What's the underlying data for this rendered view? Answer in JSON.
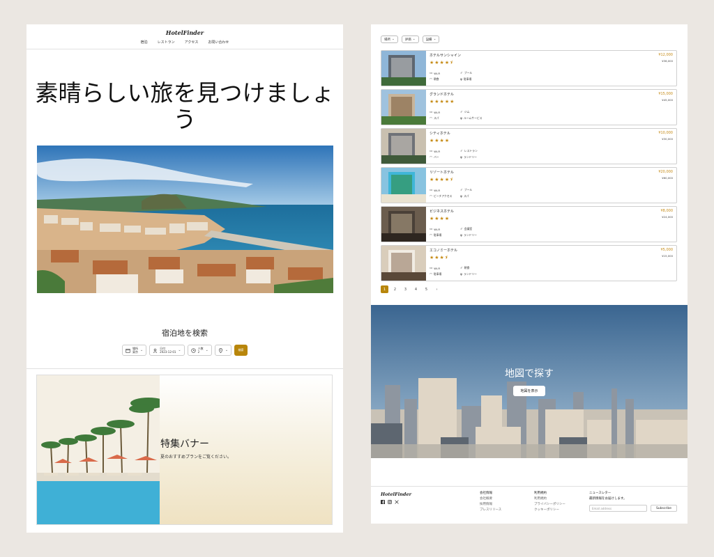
{
  "header": {
    "logo": "HotelFinder",
    "nav": [
      "宿泊",
      "レストラン",
      "アクセス",
      "お問い合わせ"
    ]
  },
  "hero": {
    "title": "素晴らしい旅を見つけましょう"
  },
  "search": {
    "title": "宿泊地を検索",
    "fields": [
      {
        "label": "場所",
        "value": "東京",
        "icon": "calendar-icon"
      },
      {
        "label": "日付",
        "value": "2023-12-01",
        "icon": "person-icon"
      },
      {
        "label": "人数",
        "value": "2",
        "icon": "clock-icon"
      },
      {
        "label": "",
        "value": "",
        "icon": "location-pin-icon"
      }
    ],
    "button": "検索"
  },
  "banner": {
    "title": "特集バナー",
    "subtitle": "夏のおすすめプランをご覧ください。"
  },
  "filters": [
    "場所",
    "評価",
    "設備"
  ],
  "hotels": [
    {
      "name": "ホテルサンシャイン",
      "stars": "★★★★⯨",
      "rating": 4.5,
      "amenities": [
        "Wi-Fi",
        "プール",
        "朝食",
        "駐車場"
      ],
      "price": "¥12,000",
      "total": "¥36,000"
    },
    {
      "name": "グランドホテル",
      "stars": "★★★★★",
      "rating": 5,
      "amenities": [
        "Wi-Fi",
        "ジム",
        "スパ",
        "ルームサービス"
      ],
      "price": "¥15,000",
      "total": "¥45,000"
    },
    {
      "name": "シティホテル",
      "stars": "★★★★",
      "rating": 4,
      "amenities": [
        "Wi-Fi",
        "レストラン",
        "バー",
        "ランドリー"
      ],
      "price": "¥10,000",
      "total": "¥30,000"
    },
    {
      "name": "リゾートホテル",
      "stars": "★★★★⯨",
      "rating": 4.5,
      "amenities": [
        "Wi-Fi",
        "プール",
        "ビーチアクセス",
        "スパ"
      ],
      "price": "¥20,000",
      "total": "¥60,000"
    },
    {
      "name": "ビジネスホテル",
      "stars": "★★★★",
      "rating": 4,
      "amenities": [
        "Wi-Fi",
        "会議室",
        "駐車場",
        "ランドリー"
      ],
      "price": "¥8,000",
      "total": "¥24,000"
    },
    {
      "name": "エコノミーホテル",
      "stars": "★★★⯨",
      "rating": 3.5,
      "amenities": [
        "Wi-Fi",
        "朝食",
        "駐車場",
        "ランドリー"
      ],
      "price": "¥5,000",
      "total": "¥15,000"
    }
  ],
  "pagination": {
    "pages": [
      "1",
      "2",
      "3",
      "4",
      "5"
    ],
    "current": "1",
    "next": "›"
  },
  "map": {
    "title": "地図で探す",
    "button": "地図を表示"
  },
  "footer": {
    "logo": "HotelFinder",
    "social": [
      "facebook-icon",
      "instagram-icon",
      "x-icon"
    ],
    "col1": {
      "title": "会社情報",
      "links": [
        "会社概要",
        "採用情報",
        "プレスリリース"
      ]
    },
    "col2": {
      "title": "利用規約",
      "links": [
        "利用規約",
        "プライバシーポリシー",
        "クッキーポリシー"
      ]
    },
    "newsletter": {
      "title": "ニュースレター",
      "text": "最新情報をお届けします。",
      "placeholder": "Email address",
      "button": "Subscribe"
    }
  },
  "colors": {
    "accent": "#b8860b",
    "star": "#c58a14",
    "background": "#ebe7e2"
  }
}
